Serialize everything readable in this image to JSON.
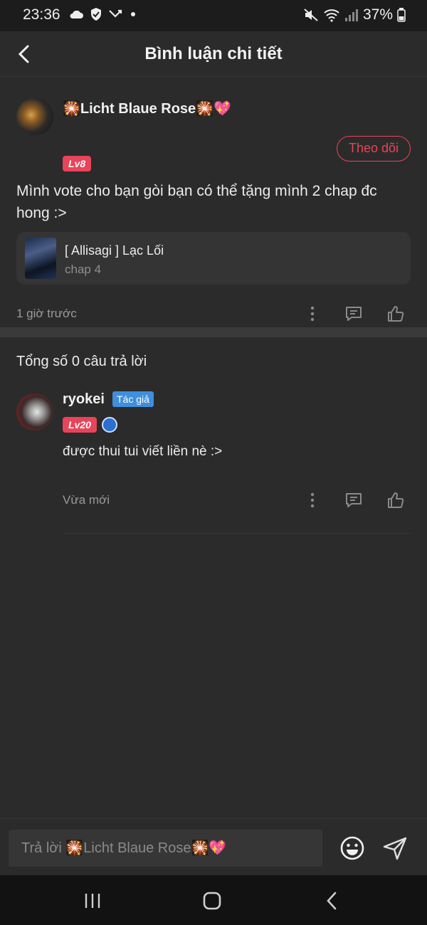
{
  "status_bar": {
    "time": "23:36",
    "battery": "37%"
  },
  "header": {
    "title": "Bình luận chi tiết"
  },
  "main_comment": {
    "username": "🎇Licht Blaue Rose🎇💖",
    "level": "Lv8",
    "follow_label": "Theo dõi",
    "text": "Mình vote cho bạn gòi bạn có thể tặng mình 2 chap đc hong :>",
    "story": {
      "title": "[ Allisagi ] Lạc Lối",
      "chapter": "chap 4"
    },
    "time": "1 giờ trước"
  },
  "replies": {
    "count_label": "Tổng số 0 câu trả lời",
    "items": [
      {
        "username": "ryokei",
        "author_badge": "Tác giả",
        "level": "Lv20",
        "text": "được thui tui viết liền nè :>",
        "time": "Vừa mới"
      }
    ]
  },
  "input": {
    "placeholder": "Trả lời 🎇Licht Blaue Rose🎇💖"
  },
  "colors": {
    "accent": "#e8445a",
    "author_badge": "#3e8fdc",
    "background": "#2b2b2b"
  },
  "icons": [
    "back-arrow-icon",
    "more-vert-icon",
    "comment-icon",
    "thumb-up-icon",
    "emoji-icon",
    "send-icon",
    "recent-apps-icon",
    "home-icon",
    "nav-back-icon"
  ]
}
